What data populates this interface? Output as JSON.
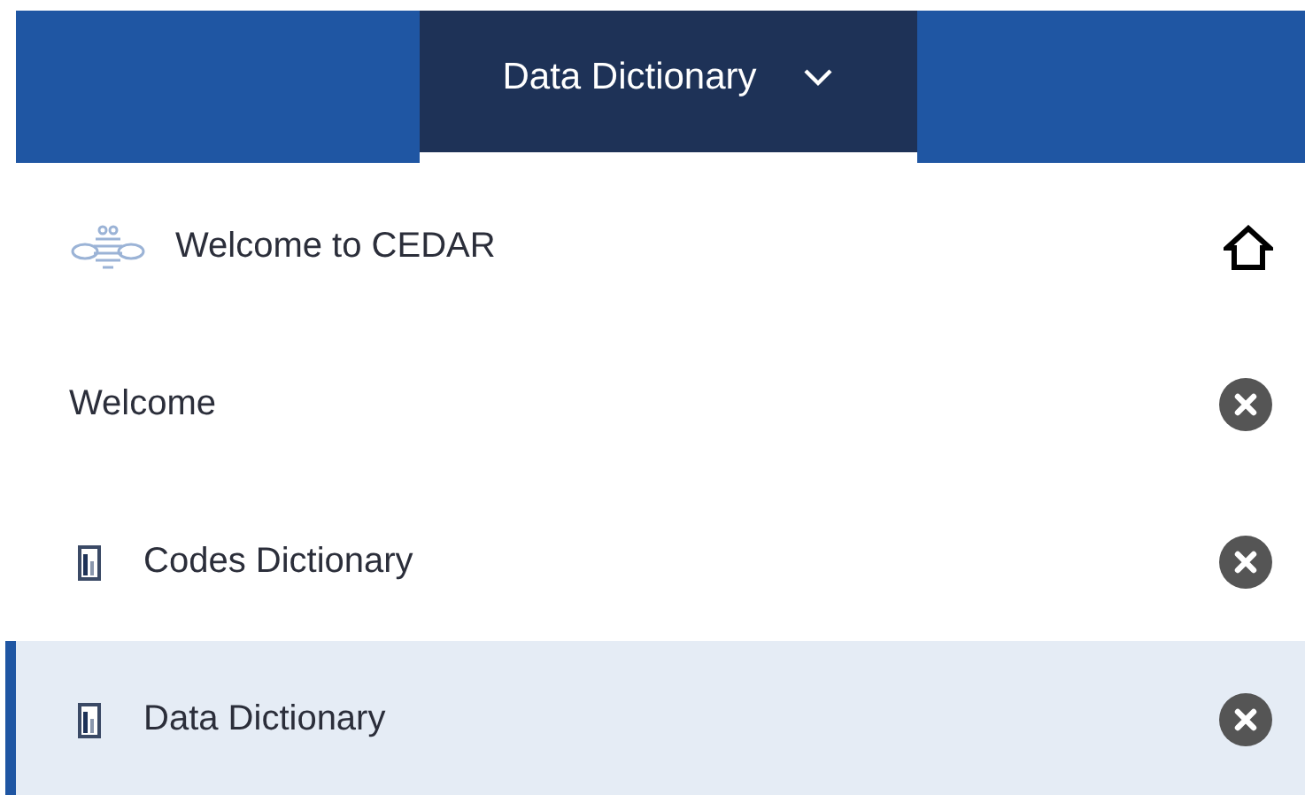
{
  "header": {
    "dropdown": {
      "label": "Data Dictionary",
      "expanded": false
    }
  },
  "menu": [
    {
      "kind": "home",
      "label": "Welcome to CEDAR",
      "selected": false
    },
    {
      "kind": "page",
      "label": "Welcome",
      "selected": false
    },
    {
      "kind": "dictionary",
      "label": "Codes Dictionary",
      "selected": false
    },
    {
      "kind": "dictionary",
      "label": "Data Dictionary",
      "selected": true
    }
  ]
}
